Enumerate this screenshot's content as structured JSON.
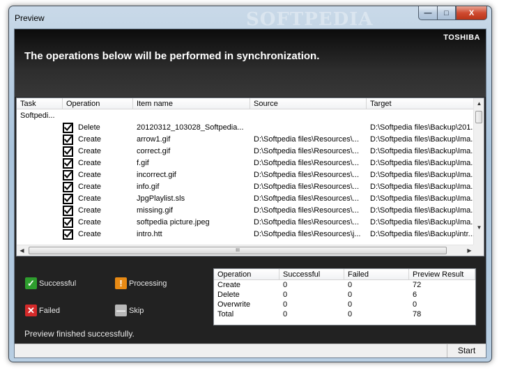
{
  "window": {
    "title": "Preview",
    "watermark": "SOFTPEDIA",
    "minimize": "—",
    "maximize": "□",
    "close": "X"
  },
  "banner": {
    "brand": "TOSHIBA",
    "heading": "The operations below will be performed in synchronization."
  },
  "list": {
    "columns": [
      "Task",
      "Operation",
      "Item name",
      "Source",
      "Target"
    ],
    "group_label": "Softpedi...",
    "rows": [
      {
        "op": "Delete",
        "item": "20120312_103028_Softpedia...",
        "source": "",
        "target": "D:\\Softpedia files\\Backup\\201..."
      },
      {
        "op": "Create",
        "item": "arrow1.gif",
        "source": "D:\\Softpedia files\\Resources\\...",
        "target": "D:\\Softpedia files\\Backup\\Ima..."
      },
      {
        "op": "Create",
        "item": "correct.gif",
        "source": "D:\\Softpedia files\\Resources\\...",
        "target": "D:\\Softpedia files\\Backup\\Ima..."
      },
      {
        "op": "Create",
        "item": "f.gif",
        "source": "D:\\Softpedia files\\Resources\\...",
        "target": "D:\\Softpedia files\\Backup\\Ima..."
      },
      {
        "op": "Create",
        "item": "incorrect.gif",
        "source": "D:\\Softpedia files\\Resources\\...",
        "target": "D:\\Softpedia files\\Backup\\Ima..."
      },
      {
        "op": "Create",
        "item": "info.gif",
        "source": "D:\\Softpedia files\\Resources\\...",
        "target": "D:\\Softpedia files\\Backup\\Ima..."
      },
      {
        "op": "Create",
        "item": "JpgPlaylist.sls",
        "source": "D:\\Softpedia files\\Resources\\...",
        "target": "D:\\Softpedia files\\Backup\\Ima..."
      },
      {
        "op": "Create",
        "item": "missing.gif",
        "source": "D:\\Softpedia files\\Resources\\...",
        "target": "D:\\Softpedia files\\Backup\\Ima..."
      },
      {
        "op": "Create",
        "item": "softpedia picture.jpeg",
        "source": "D:\\Softpedia files\\Resources\\...",
        "target": "D:\\Softpedia files\\Backup\\Ima..."
      },
      {
        "op": "Create",
        "item": "intro.htt",
        "source": "D:\\Softpedia files\\Resources\\j...",
        "target": "D:\\Softpedia files\\Backup\\intr..."
      }
    ],
    "hscroll_grip": "III"
  },
  "legend": {
    "successful": "Successful",
    "processing": "Processing",
    "failed": "Failed",
    "skip": "Skip",
    "colors": {
      "successful": "#2e9e2e",
      "processing": "#e88a14",
      "failed": "#d42a2a",
      "skip": "#b8b8b8"
    }
  },
  "summary": {
    "headers": [
      "Operation",
      "Successful",
      "Failed",
      "Preview Result"
    ],
    "rows": [
      [
        "Create",
        "0",
        "0",
        "72"
      ],
      [
        "Delete",
        "0",
        "0",
        "6"
      ],
      [
        "Overwrite",
        "0",
        "0",
        "0"
      ],
      [
        "Total",
        "0",
        "0",
        "78"
      ]
    ]
  },
  "status": "Preview finished successfully.",
  "start_label": "Start"
}
